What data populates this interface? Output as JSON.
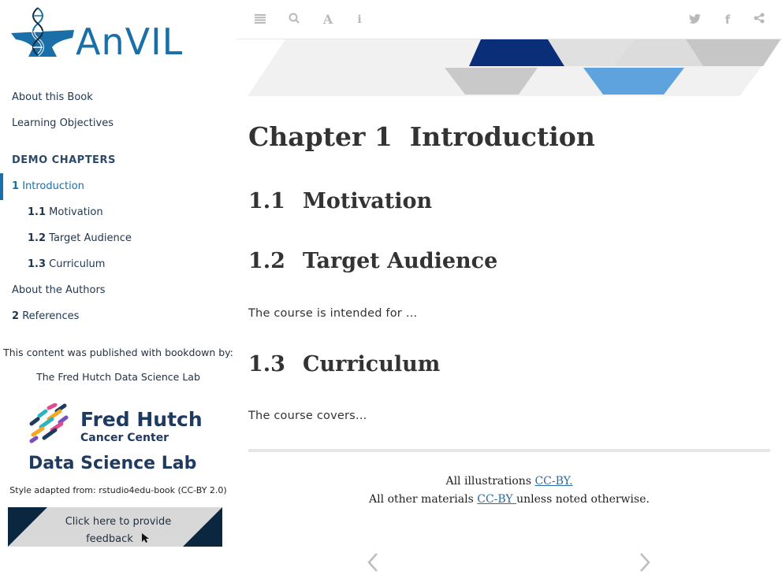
{
  "brand": {
    "logo_text": "AnVIL"
  },
  "sidebar": {
    "items": [
      {
        "label": "About this Book"
      },
      {
        "label": "Learning Objectives"
      }
    ],
    "section_header": "DEMO CHAPTERS",
    "chapters": [
      {
        "num": "1",
        "label": "Introduction",
        "active": true
      },
      {
        "num": "1.1",
        "label": "Motivation"
      },
      {
        "num": "1.2",
        "label": "Target Audience"
      },
      {
        "num": "1.3",
        "label": "Curriculum"
      }
    ],
    "about_authors": "About the Authors",
    "references": {
      "num": "2",
      "label": "References"
    },
    "published_by": "This content was published with bookdown by:",
    "lab_name": "The Fred Hutch Data Science Lab",
    "fh_logo": {
      "title": "Fred Hutch",
      "subtitle": "Cancer Center",
      "dsl": "Data Science Lab"
    },
    "style_credit": "Style adapted from: rstudio4edu-book (CC-BY 2.0)",
    "feedback": {
      "line1": "Click here to provide",
      "line2": "feedback"
    }
  },
  "toolbar": {
    "icons": [
      "menu-icon",
      "search-icon",
      "font-icon",
      "info-icon",
      "twitter-icon",
      "facebook-icon",
      "share-icon"
    ]
  },
  "main": {
    "chapter_num": "Chapter 1",
    "chapter_title": "Introduction",
    "sections": [
      {
        "num": "1.1",
        "title": "Motivation"
      },
      {
        "num": "1.2",
        "title": "Target Audience",
        "text": "The course is intended for …"
      },
      {
        "num": "1.3",
        "title": "Curriculum",
        "text": "The course covers…"
      }
    ],
    "footer": {
      "line1_prefix": "All illustrations ",
      "line1_link": "CC-BY.",
      "line2_prefix": "All other materials ",
      "line2_link": "CC-BY ",
      "line2_suffix": "unless noted otherwise."
    }
  },
  "colors": {
    "accent": "#1a6fa8",
    "navy": "#0b2740",
    "banner_blue": "#5fa3de",
    "banner_dark": "#0a2e78"
  }
}
